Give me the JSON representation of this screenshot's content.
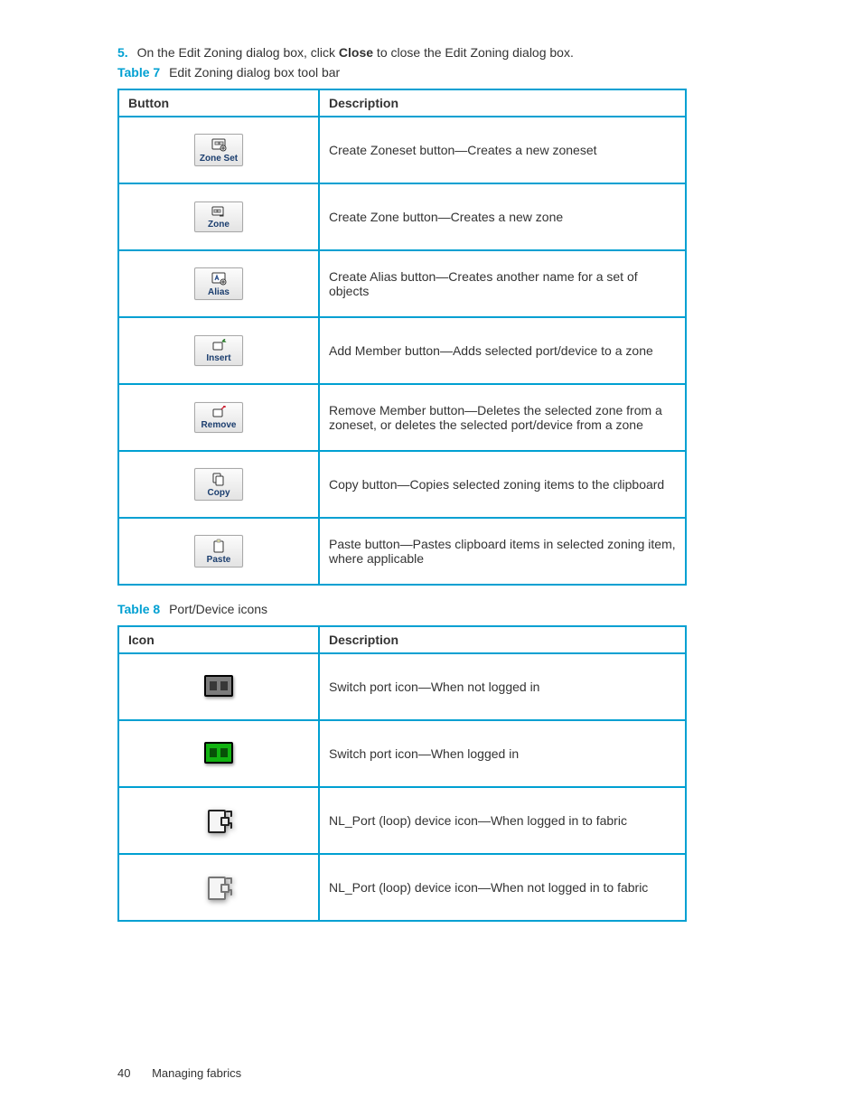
{
  "step": {
    "number": "5.",
    "text_before": "On the Edit Zoning dialog box, click ",
    "bold": "Close",
    "text_after": " to close the Edit Zoning dialog box."
  },
  "table7": {
    "label": "Table 7",
    "caption": "Edit Zoning dialog box tool bar",
    "headers": [
      "Button",
      "Description"
    ],
    "rows": [
      {
        "btn": "Zone Set",
        "desc": "Create Zoneset button—Creates a new zoneset"
      },
      {
        "btn": "Zone",
        "desc": "Create Zone button—Creates a new zone"
      },
      {
        "btn": "Alias",
        "desc": "Create Alias button—Creates another name for a set of objects"
      },
      {
        "btn": "Insert",
        "desc": "Add Member button—Adds selected port/device to a zone"
      },
      {
        "btn": "Remove",
        "desc": "Remove Member button—Deletes the selected zone from a zoneset, or deletes the selected port/device from a zone"
      },
      {
        "btn": "Copy",
        "desc": "Copy button—Copies selected zoning items to the clipboard"
      },
      {
        "btn": "Paste",
        "desc": "Paste button—Pastes clipboard items in selected zoning item, where applicable"
      }
    ]
  },
  "table8": {
    "label": "Table 8",
    "caption": "Port/Device icons",
    "headers": [
      "Icon",
      "Description"
    ],
    "rows": [
      {
        "desc": "Switch port icon—When not logged in"
      },
      {
        "desc": "Switch port icon—When logged in"
      },
      {
        "desc": "NL_Port (loop) device icon—When logged in to fabric"
      },
      {
        "desc": "NL_Port (loop) device icon—When not logged in to fabric"
      }
    ]
  },
  "footer": {
    "page": "40",
    "section": "Managing fabrics"
  }
}
